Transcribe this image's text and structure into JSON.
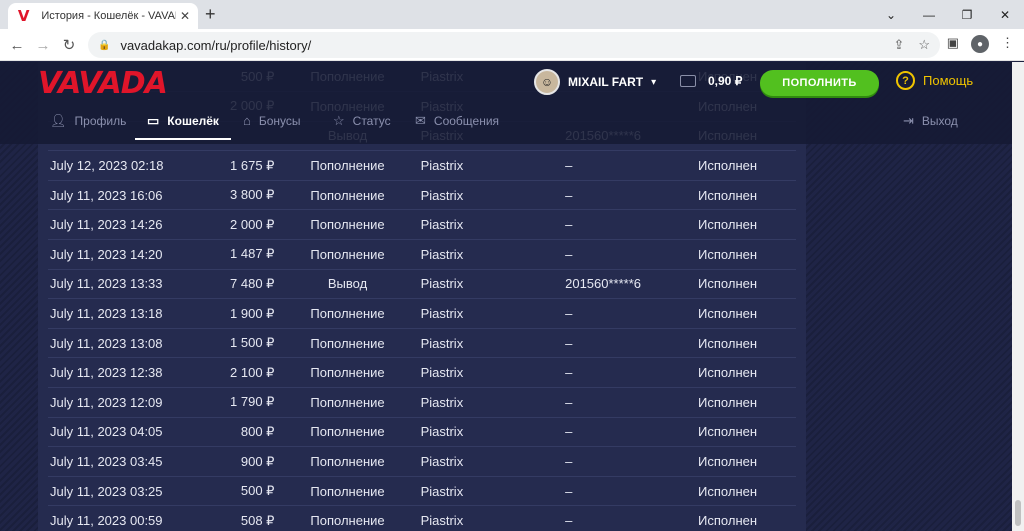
{
  "browser": {
    "tab_title": "История - Кошелёк - VAVADA О",
    "url": "vavadakap.com/ru/profile/history/"
  },
  "header": {
    "logo": "VAVADA",
    "username": "MIXAIL FART",
    "balance": "0,90 ₽",
    "deposit_label": "ПОПОЛНИТЬ",
    "help_label": "Помощь"
  },
  "subnav": {
    "profile": "Профиль",
    "wallet": "Кошелёк",
    "bonuses": "Бонусы",
    "status": "Статус",
    "messages": "Сообщения",
    "logout": "Выход"
  },
  "rows": [
    {
      "date": "",
      "amount": "500 ₽",
      "type": "Пополнение",
      "method": "Piastrix",
      "wallet": "",
      "status": "Исполнен"
    },
    {
      "date": "",
      "amount": "2 000 ₽",
      "type": "Пополнение",
      "method": "Piastrix",
      "wallet": "",
      "status": "Исполнен"
    },
    {
      "date": "",
      "amount": "",
      "type": "Вывод",
      "method": "Piastrix",
      "wallet": "201560*****6",
      "status": "Исполнен"
    },
    {
      "date": "July 12, 2023 02:18",
      "amount": "1 675 ₽",
      "type": "Пополнение",
      "method": "Piastrix",
      "wallet": "–",
      "status": "Исполнен"
    },
    {
      "date": "July 11, 2023 16:06",
      "amount": "3 800 ₽",
      "type": "Пополнение",
      "method": "Piastrix",
      "wallet": "–",
      "status": "Исполнен"
    },
    {
      "date": "July 11, 2023 14:26",
      "amount": "2 000 ₽",
      "type": "Пополнение",
      "method": "Piastrix",
      "wallet": "–",
      "status": "Исполнен"
    },
    {
      "date": "July 11, 2023 14:20",
      "amount": "1 487 ₽",
      "type": "Пополнение",
      "method": "Piastrix",
      "wallet": "–",
      "status": "Исполнен"
    },
    {
      "date": "July 11, 2023 13:33",
      "amount": "7 480 ₽",
      "type": "Вывод",
      "method": "Piastrix",
      "wallet": "201560*****6",
      "status": "Исполнен"
    },
    {
      "date": "July 11, 2023 13:18",
      "amount": "1 900 ₽",
      "type": "Пополнение",
      "method": "Piastrix",
      "wallet": "–",
      "status": "Исполнен"
    },
    {
      "date": "July 11, 2023 13:08",
      "amount": "1 500 ₽",
      "type": "Пополнение",
      "method": "Piastrix",
      "wallet": "–",
      "status": "Исполнен"
    },
    {
      "date": "July 11, 2023 12:38",
      "amount": "2 100 ₽",
      "type": "Пополнение",
      "method": "Piastrix",
      "wallet": "–",
      "status": "Исполнен"
    },
    {
      "date": "July 11, 2023 12:09",
      "amount": "1 790 ₽",
      "type": "Пополнение",
      "method": "Piastrix",
      "wallet": "–",
      "status": "Исполнен"
    },
    {
      "date": "July 11, 2023 04:05",
      "amount": "800 ₽",
      "type": "Пополнение",
      "method": "Piastrix",
      "wallet": "–",
      "status": "Исполнен"
    },
    {
      "date": "July 11, 2023 03:45",
      "amount": "900 ₽",
      "type": "Пополнение",
      "method": "Piastrix",
      "wallet": "–",
      "status": "Исполнен"
    },
    {
      "date": "July 11, 2023 03:25",
      "amount": "500 ₽",
      "type": "Пополнение",
      "method": "Piastrix",
      "wallet": "–",
      "status": "Исполнен"
    },
    {
      "date": "July 11, 2023 00:59",
      "amount": "508 ₽",
      "type": "Пополнение",
      "method": "Piastrix",
      "wallet": "–",
      "status": "Исполнен"
    }
  ]
}
